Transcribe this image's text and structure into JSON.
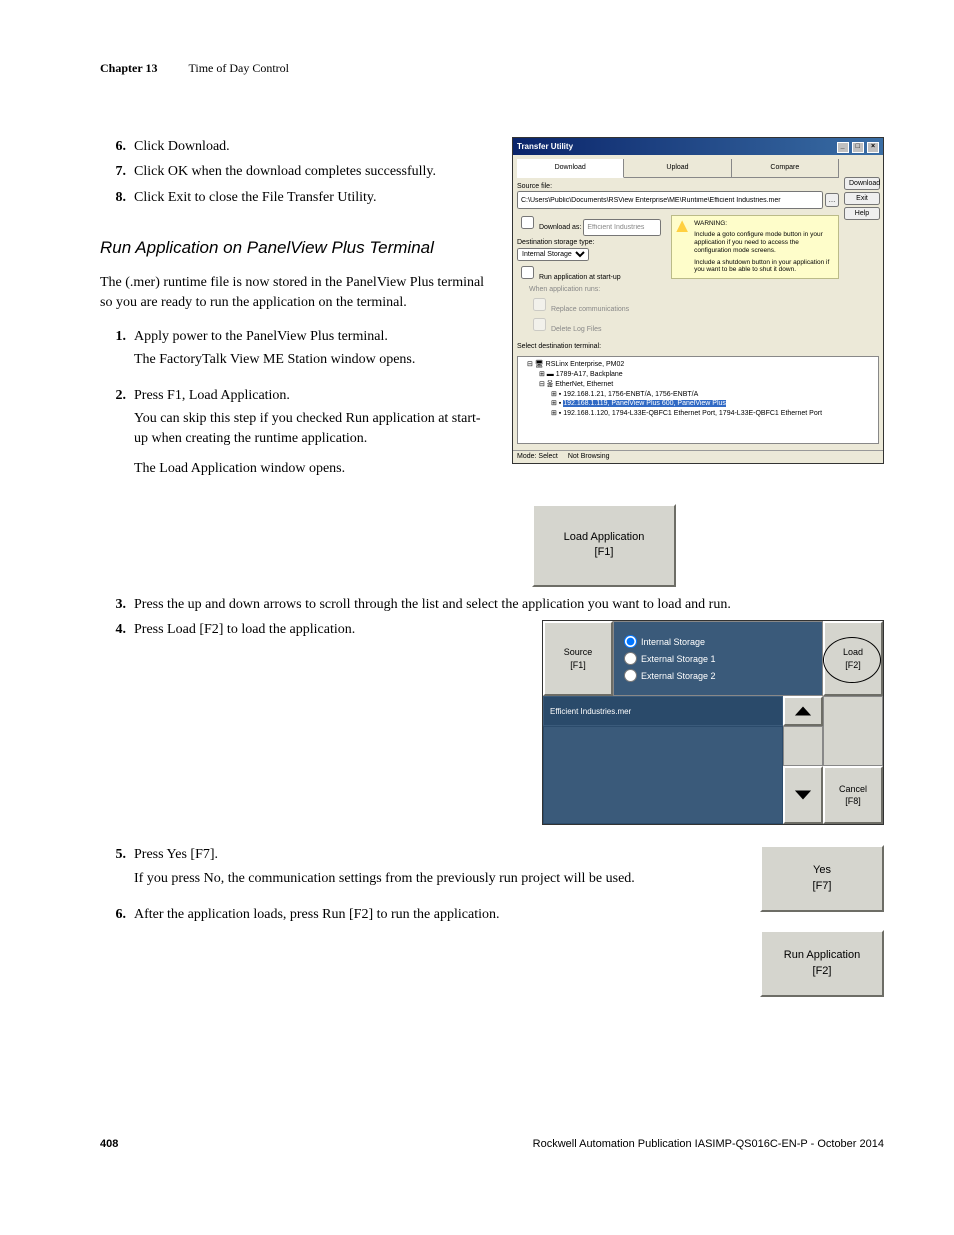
{
  "header": {
    "chapter": "Chapter 13",
    "title": "Time of Day Control"
  },
  "top_steps": [
    {
      "n": "6.",
      "text": "Click Download."
    },
    {
      "n": "7.",
      "text": "Click OK when the download completes successfully."
    },
    {
      "n": "8.",
      "text": "Click Exit to close the File Transfer Utility."
    }
  ],
  "section_heading": "Run Application on PanelView Plus Terminal",
  "intro": "The (.mer) runtime file is now stored in the PanelView Plus terminal so you are ready to run the application on the terminal.",
  "run_steps_a": [
    {
      "n": "1.",
      "text": "Apply power to the PanelView Plus terminal.",
      "extra": [
        "The FactoryTalk View ME Station window opens."
      ]
    },
    {
      "n": "2.",
      "text": "Press F1, Load Application.",
      "extra": [
        "You can skip this step if you checked Run application at start-up when creating the runtime application.",
        "The Load Application window opens."
      ]
    }
  ],
  "run_step_3": {
    "n": "3.",
    "text": "Press the up and down arrows to scroll through the list and select the application you want to load and run."
  },
  "run_step_4": {
    "n": "4.",
    "text": "Press Load [F2] to load the application."
  },
  "run_steps_b": [
    {
      "n": "5.",
      "text": "Press Yes [F7].",
      "extra": [
        "If you press No, the communication settings from the previously run project will be used."
      ]
    },
    {
      "n": "6.",
      "text": "After the application loads, press Run [F2] to run the application."
    }
  ],
  "transfer_window": {
    "title": "Transfer Utility",
    "tabs": [
      "Download",
      "Upload",
      "Compare"
    ],
    "source_label": "Source file:",
    "path": "C:\\Users\\Public\\Documents\\RSView Enterprise\\ME\\Runtime\\Efficient Industries.mer",
    "download_as_label": "Download as:",
    "download_as_value": "Efficient Industries",
    "dest_type_label": "Destination storage type:",
    "dest_type_value": "Internal Storage",
    "chk_run": "Run application at start-up",
    "chk_when": "When application runs:",
    "chk_replace": "Replace communications",
    "chk_delete": "Delete Log Files",
    "warn_heading": "WARNING:",
    "warn1": "Include a goto configure mode button in your application if you need to access the configuration mode screens.",
    "warn2": "Include a shutdown button in your application if you want to be able to shut it down.",
    "select_dest_label": "Select destination terminal:",
    "tree": {
      "root": "RSLinx Enterprise, PM02",
      "l2a": "1789-A17, Backplane",
      "l2b": "EtherNet, Ethernet",
      "l3a": "192.168.1.21, 1756-ENBT/A, 1756-ENBT/A",
      "l3b": "192.168.1.119, PanelView Plus 600, PanelView Plus",
      "l3c": "192.168.1.120, 1794-L33E-QBFC1 Ethernet Port, 1794-L33E-QBFC1 Ethernet Port"
    },
    "status": {
      "mode": "Mode: Select",
      "browse": "Not Browsing"
    },
    "buttons": {
      "download": "Download",
      "exit": "Exit",
      "help": "Help"
    }
  },
  "load_app_btn": "Load Application\n[F1]",
  "load_window": {
    "source_btn": "Source\n[F1]",
    "storage": [
      "Internal Storage",
      "External Storage 1",
      "External Storage 2"
    ],
    "load_btn": "Load\n[F2]",
    "list_header": "Efficient Industries.mer",
    "cancel_btn": "Cancel\n[F8]"
  },
  "yes_btn": "Yes\n[F7]",
  "run_btn": "Run Application\n[F2]",
  "footer": {
    "page": "408",
    "pub": "Rockwell Automation Publication IASIMP-QS016C-EN-P - October 2014"
  }
}
